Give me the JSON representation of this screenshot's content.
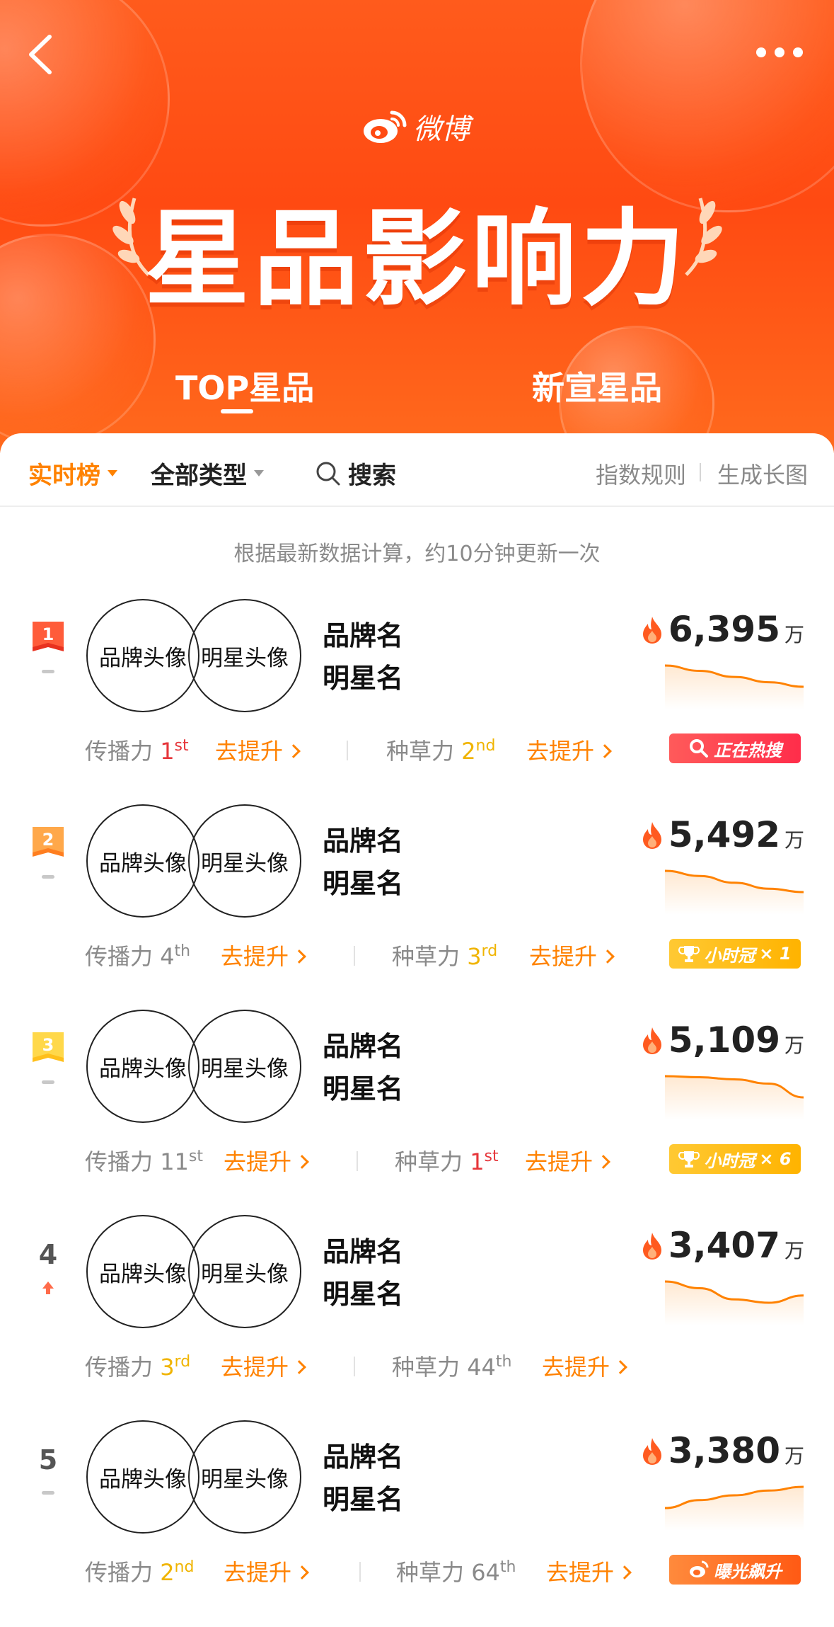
{
  "nav": {
    "back_icon": "chevron-left-icon",
    "more_icon": "ellipsis-icon",
    "logo_text": "微博",
    "title": "星品影响力",
    "tabs": [
      {
        "label": "TOP星品",
        "active": true
      },
      {
        "label": "新宣星品",
        "active": false
      }
    ]
  },
  "filters": {
    "board": "实时榜",
    "category": "全部类型",
    "search": "搜索",
    "rules": "指数规则",
    "long_image": "生成长图"
  },
  "note": "根据最新数据计算，约10分钟更新一次",
  "labels": {
    "spread": "传播力",
    "grass": "种草力",
    "improve": "去提升",
    "unit": "万"
  },
  "colors": {
    "accent": "#ff8200",
    "hero": "#ff4a12",
    "rank_red": "#e6353a",
    "rank_gold": "#f0b400"
  },
  "rows": [
    {
      "rank": "1",
      "trend": "flat",
      "brand_avatar": "品牌头像",
      "star_avatar": "明星头像",
      "brand": "品牌名",
      "star": "明星名",
      "score": "6,395",
      "trend_values": [
        100,
        93,
        85,
        78,
        72
      ],
      "spread_rank": "1",
      "spread_suffix": "st",
      "spread_color": "#e6353a",
      "grass_rank": "2",
      "grass_suffix": "nd",
      "grass_color": "#f0b400",
      "tag": {
        "type": "hot",
        "text": "正在热搜",
        "icon": "search-icon"
      }
    },
    {
      "rank": "2",
      "trend": "flat",
      "brand_avatar": "品牌头像",
      "star_avatar": "明星头像",
      "brand": "品牌名",
      "star": "明星名",
      "score": "5,492",
      "trend_values": [
        100,
        94,
        86,
        79,
        75
      ],
      "spread_rank": "4",
      "spread_suffix": "th",
      "spread_color": "#8a8a8a",
      "grass_rank": "3",
      "grass_suffix": "rd",
      "grass_color": "#f0b400",
      "tag": {
        "type": "crown",
        "text": "小时冠",
        "count": "× 1",
        "icon": "trophy-icon"
      }
    },
    {
      "rank": "3",
      "trend": "flat",
      "brand_avatar": "品牌头像",
      "star_avatar": "明星头像",
      "brand": "品牌名",
      "star": "明星名",
      "score": "5,109",
      "trend_values": [
        100,
        98,
        94,
        86,
        60
      ],
      "spread_rank": "11",
      "spread_suffix": "st",
      "spread_color": "#8a8a8a",
      "grass_rank": "1",
      "grass_suffix": "st",
      "grass_color": "#e6353a",
      "tag": {
        "type": "crown",
        "text": "小时冠",
        "count": "× 6",
        "icon": "trophy-icon"
      }
    },
    {
      "rank": "4",
      "trend": "up",
      "brand_avatar": "品牌头像",
      "star_avatar": "明星头像",
      "brand": "品牌名",
      "star": "明星名",
      "score": "3,407",
      "trend_values": [
        100,
        88,
        68,
        62,
        75
      ],
      "spread_rank": "3",
      "spread_suffix": "rd",
      "spread_color": "#f0b400",
      "grass_rank": "44",
      "grass_suffix": "th",
      "grass_color": "#8a8a8a",
      "tag": null
    },
    {
      "rank": "5",
      "trend": "flat",
      "brand_avatar": "品牌头像",
      "star_avatar": "明星头像",
      "brand": "品牌名",
      "star": "明星名",
      "score": "3,380",
      "trend_values": [
        60,
        75,
        84,
        93,
        100
      ],
      "spread_rank": "2",
      "spread_suffix": "nd",
      "spread_color": "#f0b400",
      "grass_rank": "64",
      "grass_suffix": "th",
      "grass_color": "#8a8a8a",
      "tag": {
        "type": "expo",
        "text": "曝光飙升",
        "icon": "weibo-icon"
      }
    }
  ]
}
